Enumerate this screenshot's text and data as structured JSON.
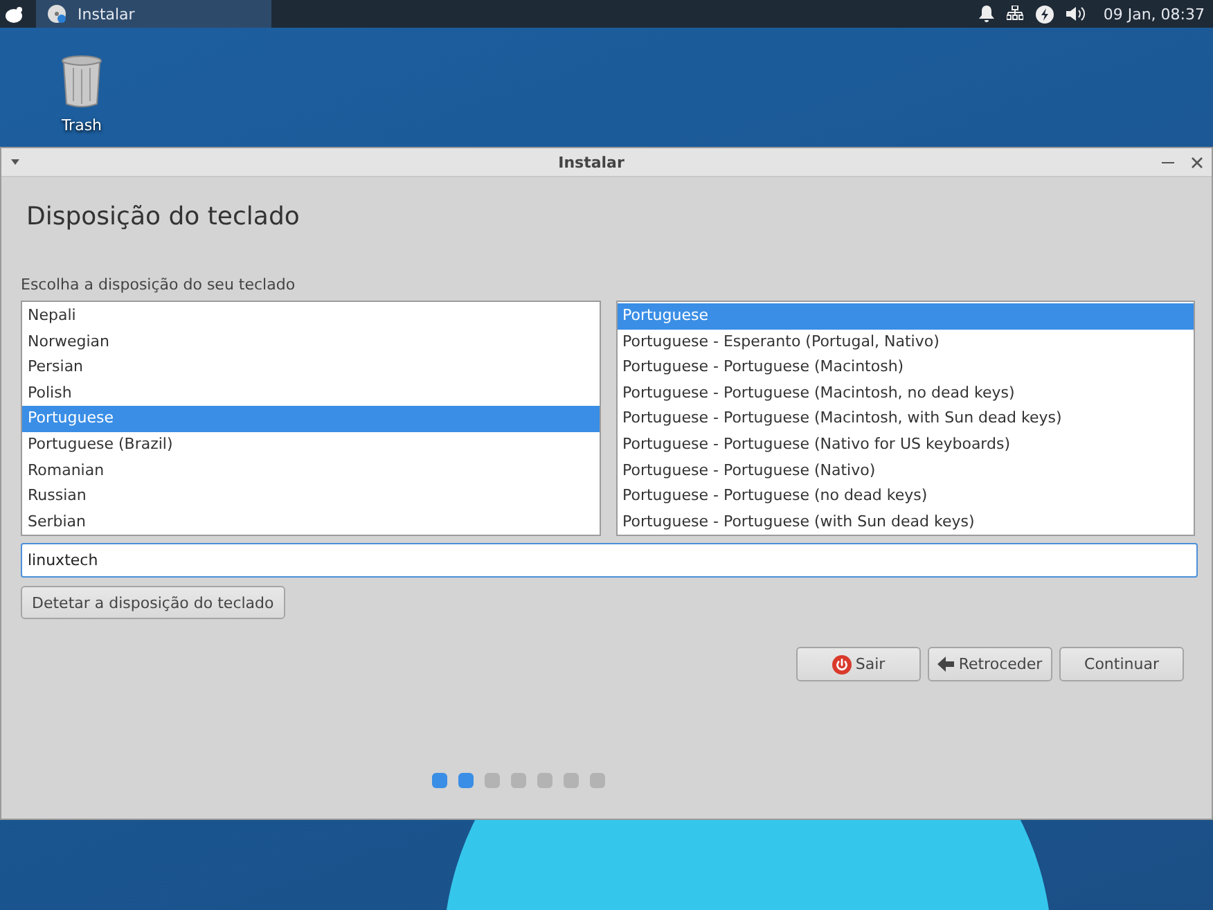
{
  "taskbar": {
    "task": {
      "label": "Instalar",
      "selected": true
    },
    "clock": "09 Jan, 08:37"
  },
  "desktop": {
    "icons": [
      {
        "label": "Trash"
      }
    ]
  },
  "window": {
    "title": "Instalar",
    "heading": "Disposição do teclado",
    "prompt": "Escolha a disposição do seu teclado",
    "layouts": [
      {
        "label": "Nepali",
        "selected": false
      },
      {
        "label": "Norwegian",
        "selected": false
      },
      {
        "label": "Persian",
        "selected": false
      },
      {
        "label": "Polish",
        "selected": false
      },
      {
        "label": "Portuguese",
        "selected": true
      },
      {
        "label": "Portuguese (Brazil)",
        "selected": false
      },
      {
        "label": "Romanian",
        "selected": false
      },
      {
        "label": "Russian",
        "selected": false
      },
      {
        "label": "Serbian",
        "selected": false
      }
    ],
    "variants": [
      {
        "label": "Portuguese",
        "selected": true
      },
      {
        "label": "Portuguese - Esperanto (Portugal, Nativo)",
        "selected": false
      },
      {
        "label": "Portuguese - Portuguese (Macintosh)",
        "selected": false
      },
      {
        "label": "Portuguese - Portuguese (Macintosh, no dead keys)",
        "selected": false
      },
      {
        "label": "Portuguese - Portuguese (Macintosh, with Sun dead keys)",
        "selected": false
      },
      {
        "label": "Portuguese - Portuguese (Nativo for US keyboards)",
        "selected": false
      },
      {
        "label": "Portuguese - Portuguese (Nativo)",
        "selected": false
      },
      {
        "label": "Portuguese - Portuguese (no dead keys)",
        "selected": false
      },
      {
        "label": "Portuguese - Portuguese (with Sun dead keys)",
        "selected": false
      }
    ],
    "test_field": {
      "value": "linuxtech"
    },
    "detect_button": "Detetar a disposição do teclado",
    "buttons": [
      {
        "kind": "quit",
        "label": "Sair"
      },
      {
        "kind": "back",
        "label": "Retroceder"
      },
      {
        "kind": "next",
        "label": "Continuar"
      }
    ],
    "steps": [
      {
        "completed": true
      },
      {
        "completed": true
      },
      {
        "completed": false
      },
      {
        "completed": false
      },
      {
        "completed": false
      },
      {
        "completed": false
      },
      {
        "completed": false
      }
    ]
  }
}
